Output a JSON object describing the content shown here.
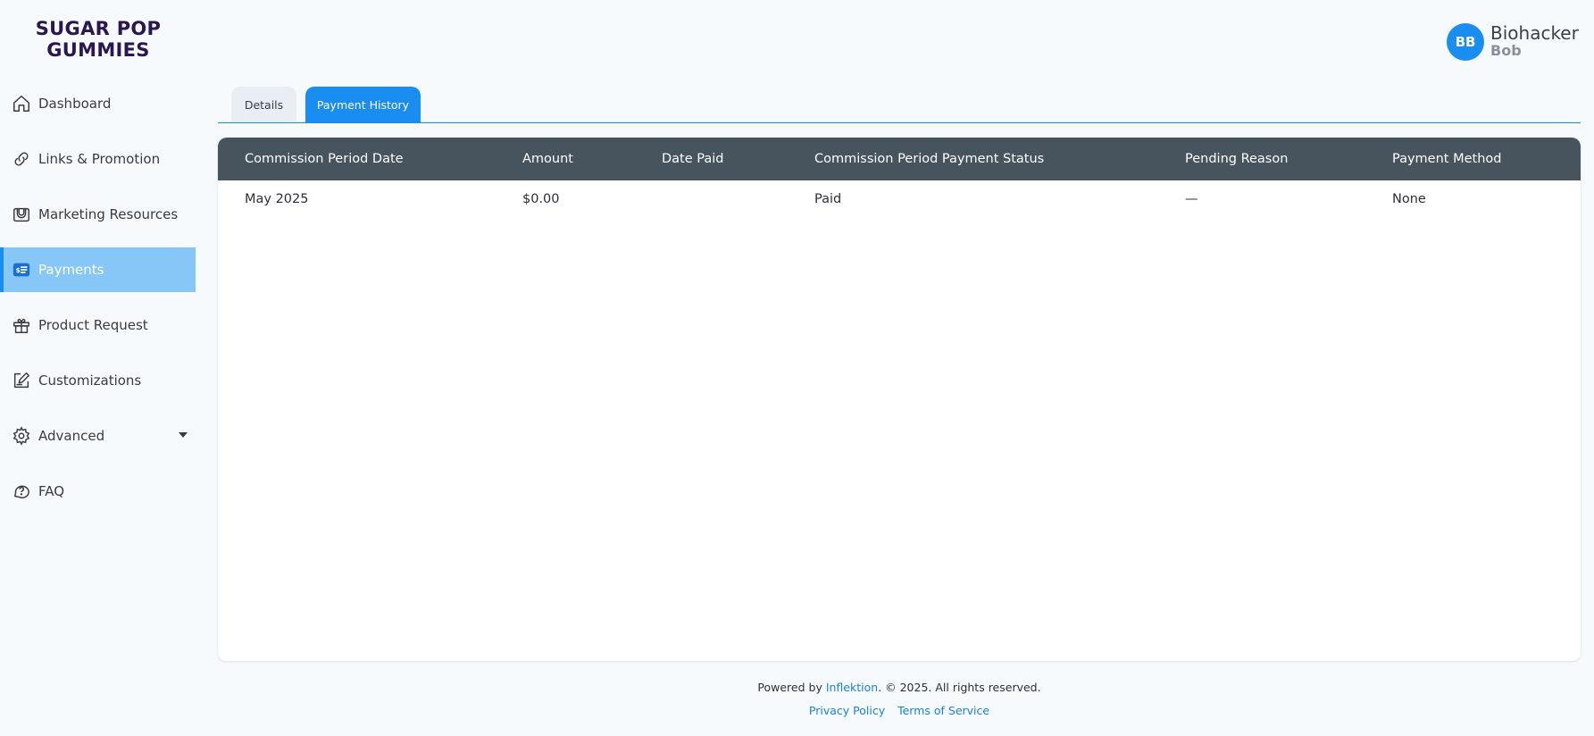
{
  "brand": {
    "line1": "SUGAR POP",
    "line2": "GUMMIES",
    "color": "#2a1650"
  },
  "sidebar": {
    "items": [
      {
        "label": "Dashboard",
        "icon": "home-icon"
      },
      {
        "label": "Links & Promotion",
        "icon": "link-icon"
      },
      {
        "label": "Marketing Resources",
        "icon": "folder-icon"
      },
      {
        "label": "Payments",
        "icon": "payments-icon",
        "active": true
      },
      {
        "label": "Product Request",
        "icon": "gift-icon"
      },
      {
        "label": "Customizations",
        "icon": "edit-icon"
      },
      {
        "label": "Advanced",
        "icon": "gear-icon",
        "has_dropdown": true
      },
      {
        "label": "FAQ",
        "icon": "help-chat-icon"
      }
    ]
  },
  "user": {
    "initials": "BB",
    "first_name": "Biohacker",
    "last_name": "Bob"
  },
  "tabs": [
    {
      "label": "Details",
      "active": false
    },
    {
      "label": "Payment History",
      "active": true
    }
  ],
  "table": {
    "headers": [
      "Commission Period Date",
      "Amount",
      "Date Paid",
      "Commission Period Payment Status",
      "Pending Reason",
      "Payment Method"
    ],
    "rows": [
      [
        "May 2025",
        "$0.00",
        "",
        "Paid",
        "—",
        "None"
      ]
    ]
  },
  "footer": {
    "powered_prefix": "Powered by ",
    "powered_link": "Inflektion",
    "powered_suffix": ". © 2025. All rights reserved.",
    "privacy": "Privacy Policy",
    "terms": "Terms of Service"
  },
  "colors": {
    "accent": "#1a8ef0",
    "active_bg": "#86c7f8",
    "table_header": "#47535d"
  }
}
